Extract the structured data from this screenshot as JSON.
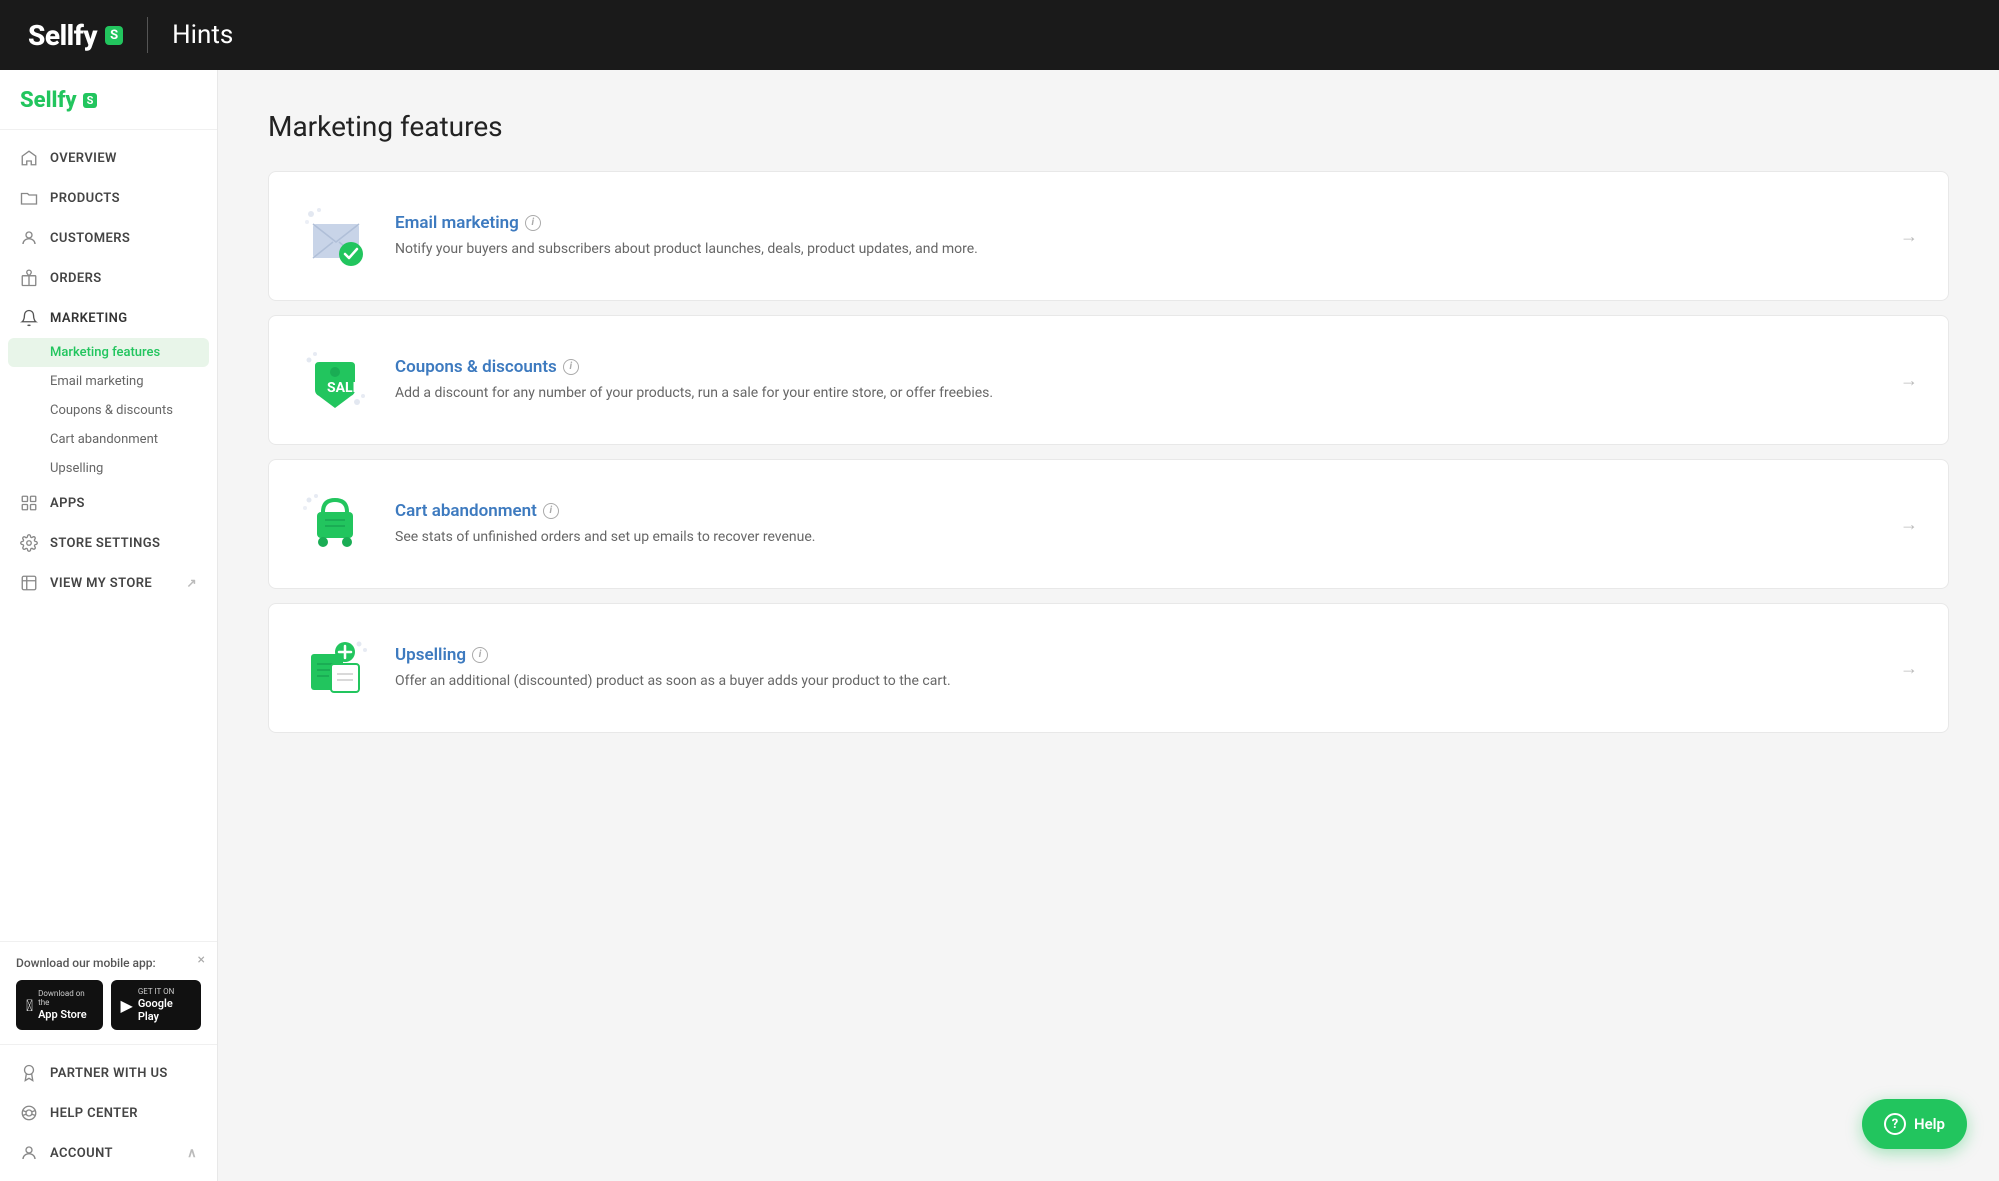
{
  "topHeader": {
    "logoText": "Sellfy",
    "logoBadge": "S",
    "pageTitle": "Hints"
  },
  "sidebar": {
    "logoText": "Sellfy",
    "logoBadge": "S",
    "navItems": [
      {
        "id": "overview",
        "label": "Overview",
        "icon": "home"
      },
      {
        "id": "products",
        "label": "Products",
        "icon": "folder"
      },
      {
        "id": "customers",
        "label": "Customers",
        "icon": "person"
      },
      {
        "id": "orders",
        "label": "Orders",
        "icon": "gift"
      },
      {
        "id": "marketing",
        "label": "Marketing",
        "icon": "bell",
        "active": true,
        "subItems": [
          {
            "id": "marketing-features",
            "label": "Marketing features",
            "active": true
          },
          {
            "id": "email-marketing",
            "label": "Email marketing"
          },
          {
            "id": "coupons-discounts",
            "label": "Coupons & discounts"
          },
          {
            "id": "cart-abandonment",
            "label": "Cart abandonment"
          },
          {
            "id": "upselling",
            "label": "Upselling"
          }
        ]
      },
      {
        "id": "apps",
        "label": "Apps",
        "icon": "grid"
      },
      {
        "id": "store-settings",
        "label": "Store Settings",
        "icon": "gear"
      },
      {
        "id": "view-my-store",
        "label": "View My Store",
        "icon": "external"
      }
    ],
    "mobileApp": {
      "title": "Download our mobile app:",
      "closeLabel": "×",
      "appStore": {
        "sub": "Download on the",
        "main": "App Store"
      },
      "googlePlay": {
        "sub": "GET IT ON",
        "main": "Google Play"
      }
    },
    "bottomItems": [
      {
        "id": "partner-with-us",
        "label": "Partner With Us",
        "icon": "award"
      },
      {
        "id": "help-center",
        "label": "Help Center",
        "icon": "lifesaver"
      },
      {
        "id": "account",
        "label": "Account",
        "icon": "person-circle"
      }
    ]
  },
  "content": {
    "pageTitle": "Marketing features",
    "featureCards": [
      {
        "id": "email-marketing",
        "title": "Email marketing",
        "description": "Notify your buyers and subscribers about product launches, deals, product updates, and more.",
        "hasInfo": true
      },
      {
        "id": "coupons-discounts",
        "title": "Coupons & discounts",
        "description": "Add a discount for any number of your products, run a sale for your entire store, or offer freebies.",
        "hasInfo": true
      },
      {
        "id": "cart-abandonment",
        "title": "Cart abandonment",
        "description": "See stats of unfinished orders and set up emails to recover revenue.",
        "hasInfo": true
      },
      {
        "id": "upselling",
        "title": "Upselling",
        "description": "Offer an additional (discounted) product as soon as a buyer adds your product to the cart.",
        "hasInfo": true
      }
    ]
  },
  "helpButton": {
    "label": "Help",
    "icon": "?"
  }
}
